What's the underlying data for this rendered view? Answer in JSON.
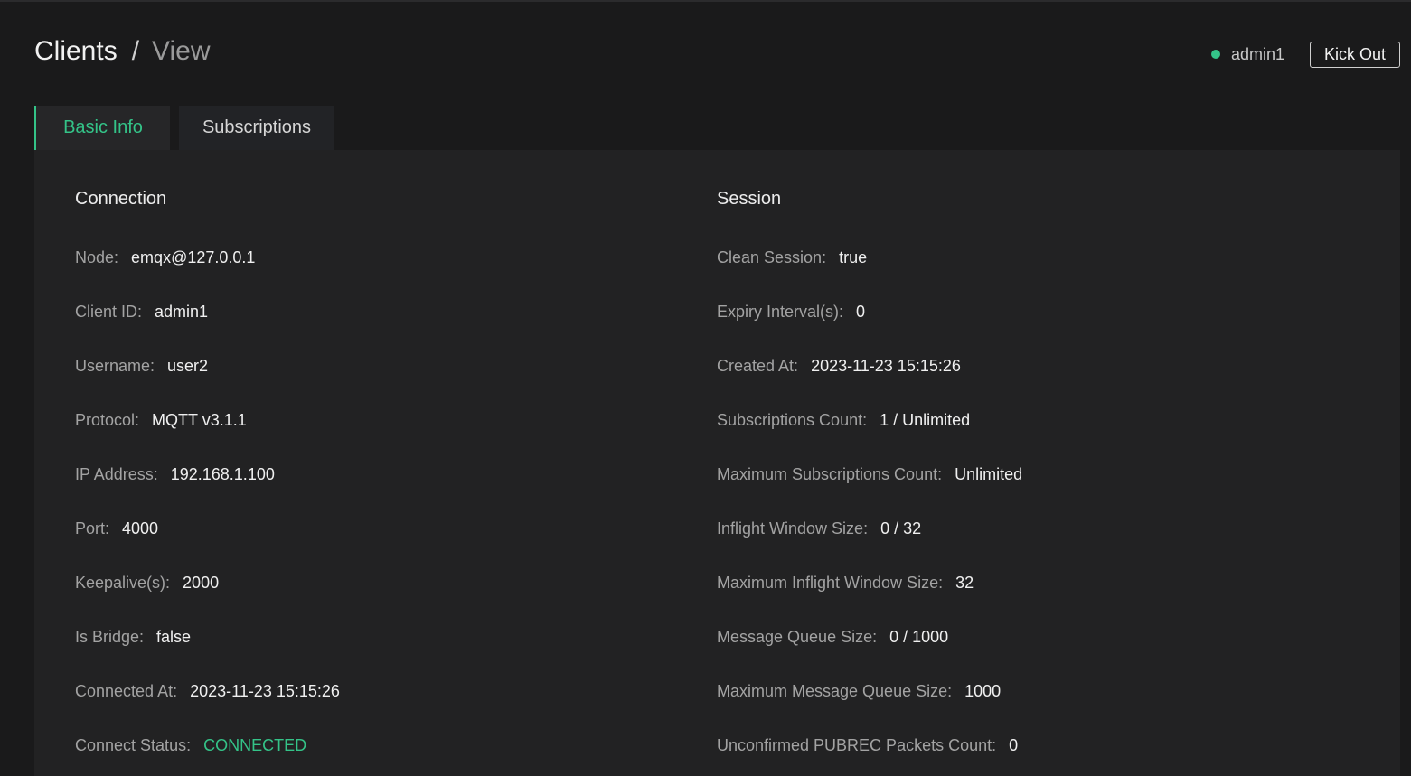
{
  "header": {
    "title": "Clients",
    "separator": "/",
    "subtitle": "View",
    "client_name": "admin1",
    "status_color": "#34c388",
    "kick_out_label": "Kick Out"
  },
  "tabs": [
    {
      "label": "Basic Info",
      "active": true
    },
    {
      "label": "Subscriptions",
      "active": false
    }
  ],
  "connection": {
    "title": "Connection",
    "rows": [
      {
        "label": "Node:",
        "value": "emqx@127.0.0.1"
      },
      {
        "label": "Client ID:",
        "value": "admin1"
      },
      {
        "label": "Username:",
        "value": "user2"
      },
      {
        "label": "Protocol:",
        "value": "MQTT v3.1.1"
      },
      {
        "label": "IP Address:",
        "value": "192.168.1.100"
      },
      {
        "label": "Port:",
        "value": "4000"
      },
      {
        "label": "Keepalive(s):",
        "value": "2000"
      },
      {
        "label": "Is Bridge:",
        "value": "false"
      },
      {
        "label": "Connected At:",
        "value": "2023-11-23 15:15:26"
      },
      {
        "label": "Connect Status:",
        "value": "CONNECTED"
      }
    ]
  },
  "session": {
    "title": "Session",
    "rows": [
      {
        "label": "Clean Session:",
        "value": "true"
      },
      {
        "label": "Expiry Interval(s):",
        "value": "0"
      },
      {
        "label": "Created At:",
        "value": "2023-11-23 15:15:26"
      },
      {
        "label": "Subscriptions Count:",
        "value": "1 / Unlimited"
      },
      {
        "label": "Maximum Subscriptions Count:",
        "value": "Unlimited"
      },
      {
        "label": "Inflight Window Size:",
        "value": "0 / 32"
      },
      {
        "label": "Maximum Inflight Window Size:",
        "value": "32"
      },
      {
        "label": "Message Queue Size:",
        "value": "0 / 1000"
      },
      {
        "label": "Maximum Message Queue Size:",
        "value": "1000"
      },
      {
        "label": "Unconfirmed PUBREC Packets Count:",
        "value": "0"
      }
    ]
  }
}
